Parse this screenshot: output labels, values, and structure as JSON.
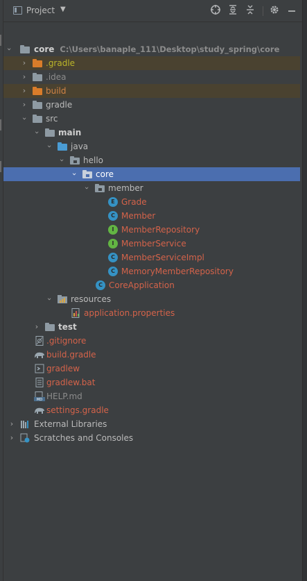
{
  "toolbar": {
    "title": "Project",
    "caret": "▼",
    "icons": [
      "crosshair-icon",
      "expand-all-icon",
      "collapse-all-icon",
      "gear-icon",
      "minimize-icon"
    ]
  },
  "tree": {
    "root": {
      "label": "core",
      "path": "C:\\Users\\banaple_111\\Desktop\\study_spring\\core"
    },
    "items": [
      {
        "label": ".gradle"
      },
      {
        "label": ".idea"
      },
      {
        "label": "build"
      },
      {
        "label": "gradle"
      },
      {
        "label": "src"
      },
      {
        "label": "main"
      },
      {
        "label": "java"
      },
      {
        "label": "hello"
      },
      {
        "label": "core"
      },
      {
        "label": "member"
      },
      {
        "label": "Grade",
        "kind": "E"
      },
      {
        "label": "Member",
        "kind": "C"
      },
      {
        "label": "MemberRepository",
        "kind": "I"
      },
      {
        "label": "MemberService",
        "kind": "I"
      },
      {
        "label": "MemberServiceImpl",
        "kind": "C"
      },
      {
        "label": "MemoryMemberRepository",
        "kind": "C"
      },
      {
        "label": "CoreApplication",
        "kind": "C"
      },
      {
        "label": "resources"
      },
      {
        "label": "application.properties"
      },
      {
        "label": "test"
      },
      {
        "label": ".gitignore"
      },
      {
        "label": "build.gradle"
      },
      {
        "label": "gradlew"
      },
      {
        "label": "gradlew.bat"
      },
      {
        "label": "HELP.md"
      },
      {
        "label": "settings.gradle"
      },
      {
        "label": "External Libraries"
      },
      {
        "label": "Scratches and Consoles"
      }
    ]
  },
  "colors": {
    "background": "#3c3f41",
    "selection": "#4b6eaf",
    "excluded": "#4a4230",
    "modified_text": "#d4634a",
    "excluded_text": "#d28445"
  }
}
